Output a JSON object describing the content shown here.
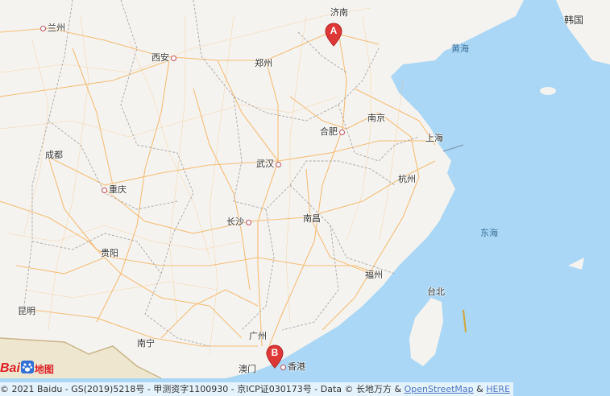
{
  "map": {
    "colors": {
      "sea": "#a9d7f5",
      "land": "#f5f3ef",
      "road": "#f6b86a",
      "border": "#a7a7a7",
      "marker": "#de3737"
    },
    "cities": [
      {
        "id": "lanzhou",
        "label": "兰州"
      },
      {
        "id": "xian",
        "label": "西安"
      },
      {
        "id": "zhengzhou",
        "label": "郑州"
      },
      {
        "id": "jinan",
        "label": "济南"
      },
      {
        "id": "hefei",
        "label": "合肥"
      },
      {
        "id": "nanjing",
        "label": "南京"
      },
      {
        "id": "shanghai",
        "label": "上海"
      },
      {
        "id": "hangzhou",
        "label": "杭州"
      },
      {
        "id": "chengdu",
        "label": "成都"
      },
      {
        "id": "wuhan",
        "label": "武汉"
      },
      {
        "id": "chongqing",
        "label": "重庆"
      },
      {
        "id": "changsha",
        "label": "长沙"
      },
      {
        "id": "nanchang",
        "label": "南昌"
      },
      {
        "id": "guiyang",
        "label": "贵阳"
      },
      {
        "id": "fuzhou",
        "label": "福州"
      },
      {
        "id": "kunming",
        "label": "昆明"
      },
      {
        "id": "nanning",
        "label": "南宁"
      },
      {
        "id": "guangzhou",
        "label": "广州"
      },
      {
        "id": "macau",
        "label": "澳门"
      },
      {
        "id": "hongkong",
        "label": "香港"
      },
      {
        "id": "taipei",
        "label": "台北"
      }
    ],
    "regions": {
      "yellow_sea": "黄海",
      "east_sea": "东海",
      "korea": "韩国"
    },
    "markers": [
      {
        "id": "A",
        "label": "A"
      },
      {
        "id": "B",
        "label": "B"
      }
    ]
  },
  "logo": {
    "text_left": "Bai",
    "text_right": "地图"
  },
  "footer": {
    "copyright": "© 2021 Baidu - GS(2019)5218号 - 甲测资字1100930 - 京ICP证030173号 - Data © 长地万方 & ",
    "osm_link": "OpenStreetMap",
    "amp": " & ",
    "here_link": "HERE"
  }
}
